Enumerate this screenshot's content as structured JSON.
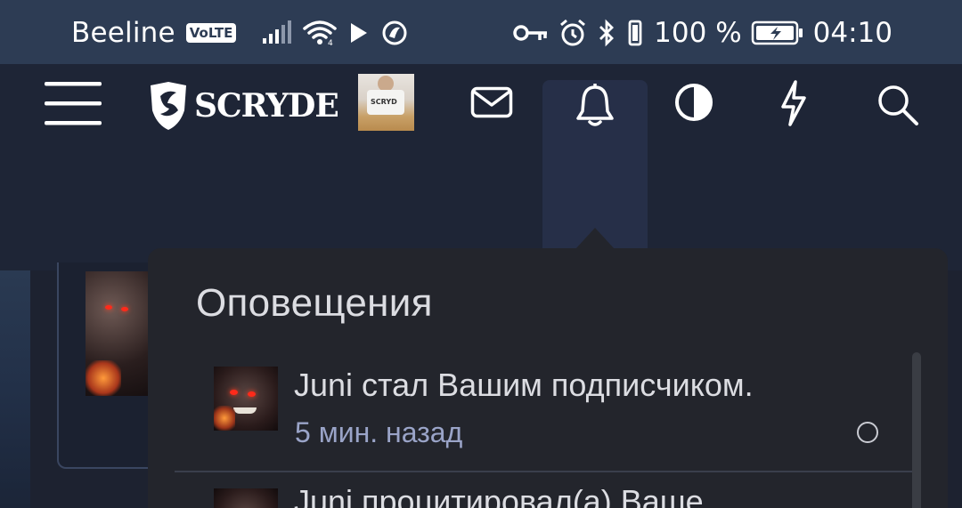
{
  "status_bar": {
    "carrier": "Beeline",
    "volte": "VoLTE",
    "battery_percent": "100 %",
    "time": "04:10"
  },
  "header": {
    "logo_text": "SCRYDE",
    "user_avatar_text": "SCRYD",
    "icons": [
      "menu-icon",
      "mail-icon",
      "bell-icon",
      "theme-toggle-icon",
      "bolt-icon",
      "search-icon"
    ]
  },
  "notifications": {
    "title": "Оповещения",
    "items": [
      {
        "text": "Juni стал Вашим подписчиком.",
        "time": "5 мин. назад"
      },
      {
        "text": "Juni процитировал(а) Ваше"
      }
    ]
  }
}
